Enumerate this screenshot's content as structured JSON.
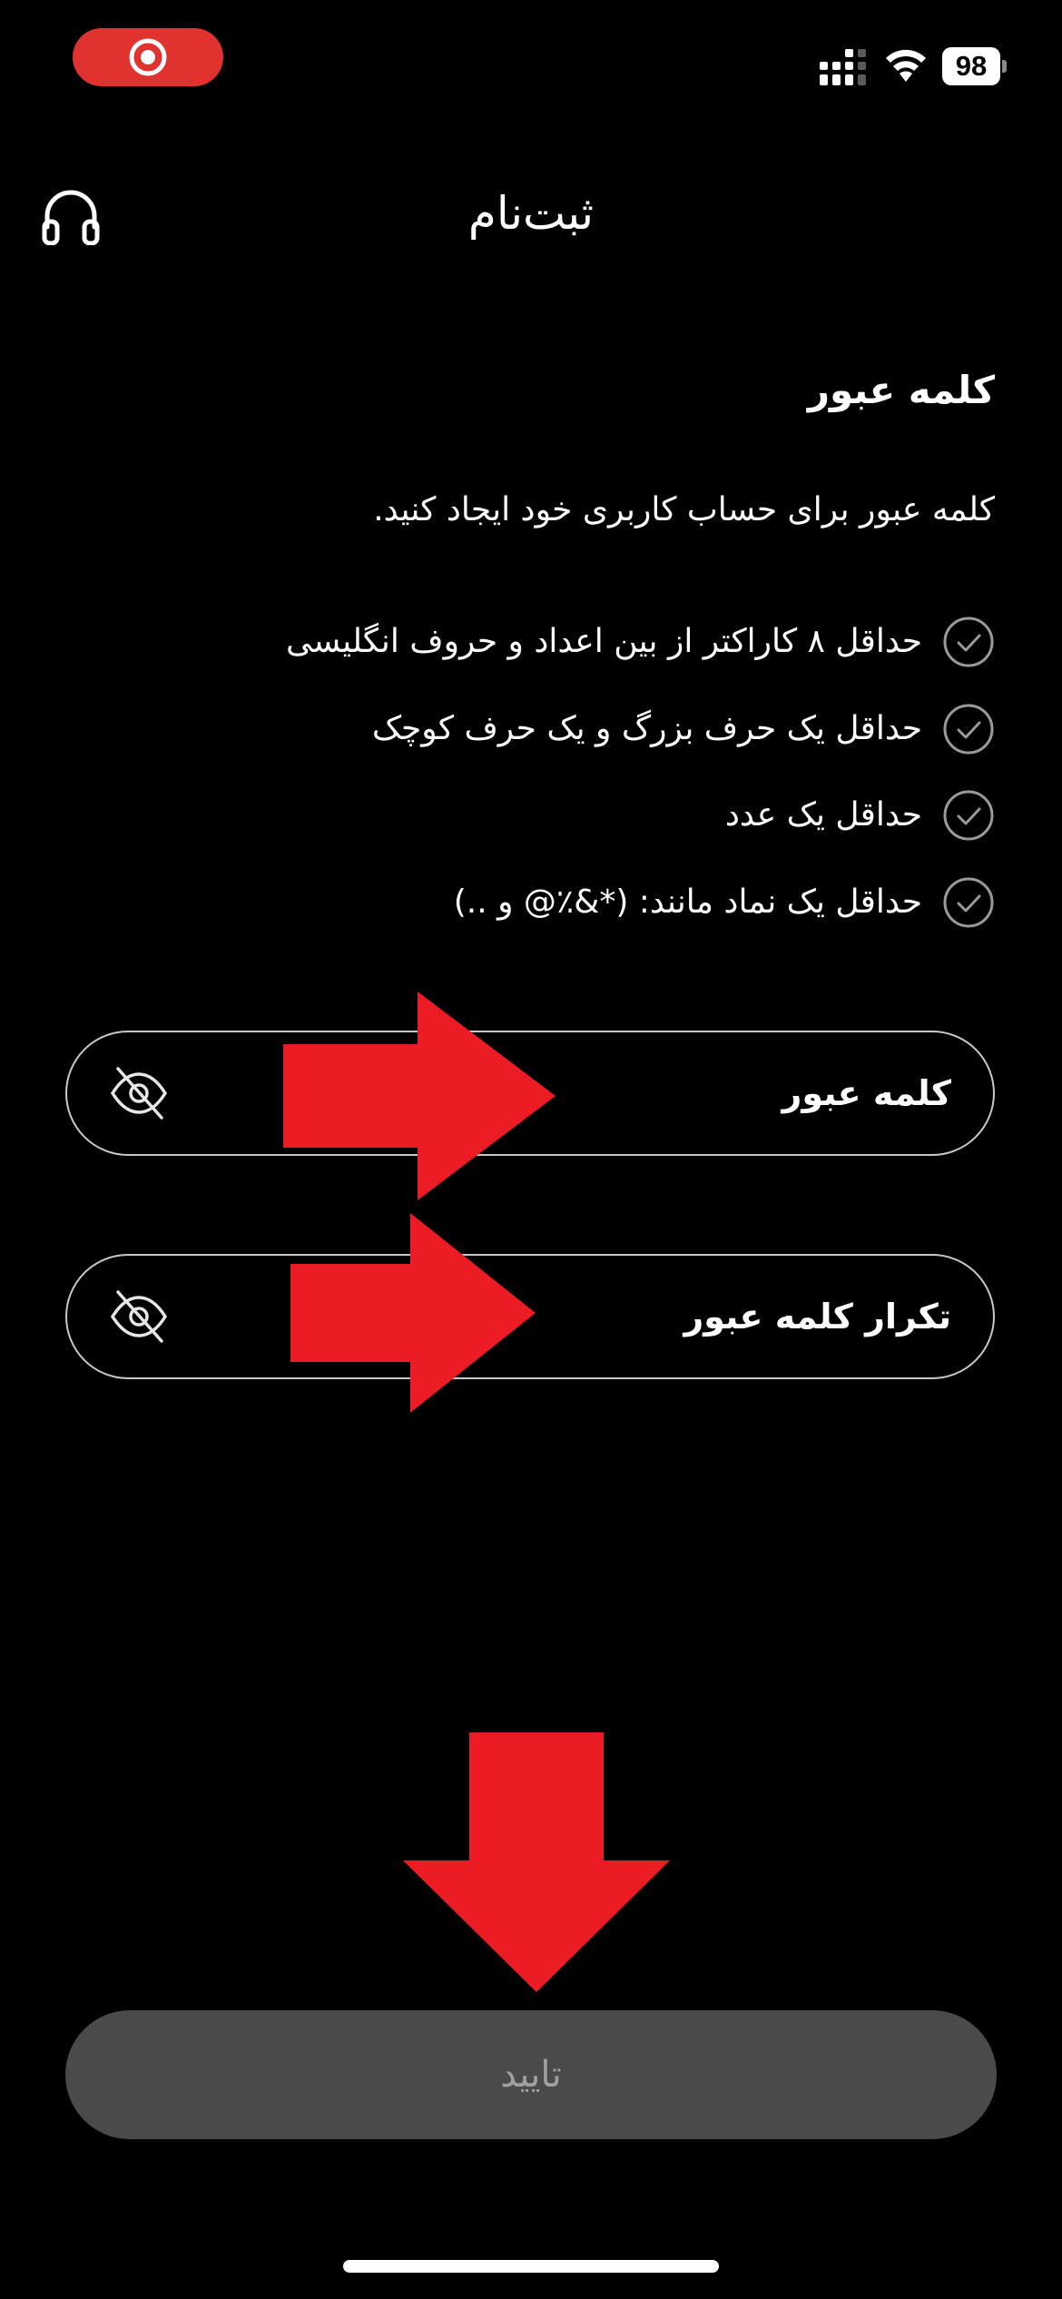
{
  "status_bar": {
    "battery_level": "98",
    "icons": [
      "record-icon",
      "signal-icon",
      "wifi-icon",
      "battery-icon"
    ],
    "recording_color": "#e0322f"
  },
  "header": {
    "title": "ثبت‌نام",
    "support_icon": "headphones-icon"
  },
  "content": {
    "section_title": "کلمه عبور",
    "description": "کلمه عبور برای حساب کاربری خود ایجاد کنید.",
    "requirements": [
      {
        "text": "حداقل ۸ کاراکتر از بین اعداد و حروف انگلیسی",
        "icon": "check-circle-icon"
      },
      {
        "text": "حداقل یک حرف بزرگ و یک حرف کوچک",
        "icon": "check-circle-icon"
      },
      {
        "text": "حداقل یک عدد",
        "icon": "check-circle-icon"
      },
      {
        "text": "حداقل یک نماد مانند: (*&٪@ و ..)",
        "icon": "check-circle-icon"
      }
    ]
  },
  "form": {
    "password_label": "کلمه عبور",
    "confirm_password_label": "تکرار کلمه عبور",
    "visibility_icon": "eye-off-icon"
  },
  "confirm_button": {
    "label": "تایید",
    "background": "#4a4a4a",
    "text_color": "#a0a0a0"
  },
  "annotations": {
    "arrow_color": "#ec1c24",
    "arrows": [
      "arrow-right",
      "arrow-right",
      "arrow-down"
    ]
  }
}
